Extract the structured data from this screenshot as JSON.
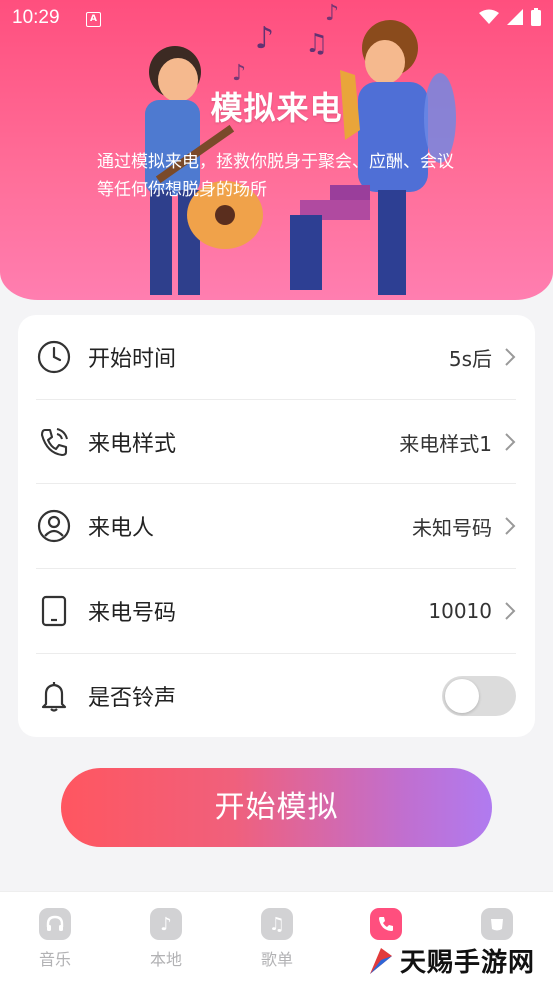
{
  "status_bar": {
    "time": "10:29",
    "notif_icon": "a-letter-icon"
  },
  "hero": {
    "title": "模拟来电",
    "description": "通过模拟来电，拯救你脱身于聚会、应酬、会议等任何你想脱身的场所"
  },
  "settings": [
    {
      "icon": "clock-icon",
      "label": "开始时间",
      "value": "5s后"
    },
    {
      "icon": "phone-call-icon",
      "label": "来电样式",
      "value": "来电样式1"
    },
    {
      "icon": "person-icon",
      "label": "来电人",
      "value": "未知号码"
    },
    {
      "icon": "tablet-icon",
      "label": "来电号码",
      "value": "10010"
    },
    {
      "icon": "bell-icon",
      "label": "是否铃声",
      "toggle_on": false
    }
  ],
  "start_button": {
    "label": "开始模拟"
  },
  "tabs": [
    {
      "icon": "headphones-icon",
      "label": "音乐"
    },
    {
      "icon": "music-note-icon",
      "label": "本地"
    },
    {
      "icon": "playlist-icon",
      "label": "歌单"
    },
    {
      "icon": "phone-icon",
      "label": "",
      "active": true
    },
    {
      "icon": "cup-icon",
      "label": ""
    }
  ],
  "watermark": {
    "text": "天赐手游网"
  },
  "colors": {
    "accent": "#ff4f7e",
    "button_start": "#ff5660",
    "button_end": "#b07bf0"
  }
}
